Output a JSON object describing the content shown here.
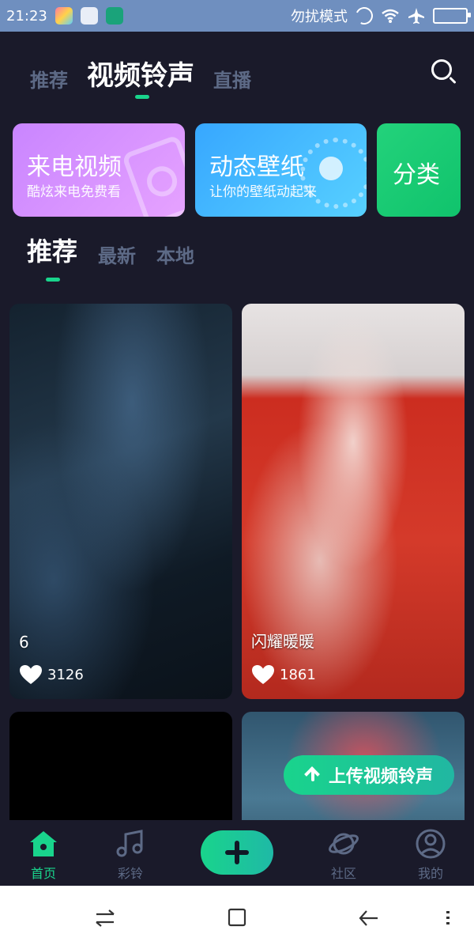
{
  "status_bar": {
    "time": "21:23",
    "status_text": "勿扰模式",
    "icons": [
      "photo-app-icon",
      "cleaner-icon",
      "usb-icon",
      "moon-icon",
      "wifi-icon",
      "airplane-icon",
      "battery-icon"
    ]
  },
  "top_tabs": [
    {
      "label": "推荐",
      "active": false
    },
    {
      "label": "视频铃声",
      "active": true
    },
    {
      "label": "直播",
      "active": false
    }
  ],
  "cards": [
    {
      "title": "来电视频",
      "subtitle": "酷炫来电免费看"
    },
    {
      "title": "动态壁纸",
      "subtitle": "让你的壁纸动起来"
    },
    {
      "title": "分类",
      "subtitle": ""
    }
  ],
  "section_tabs": [
    {
      "label": "推荐",
      "active": true
    },
    {
      "label": "最新",
      "active": false
    },
    {
      "label": "本地",
      "active": false
    }
  ],
  "videos": [
    {
      "title": "6",
      "likes": "3126"
    },
    {
      "title": "闪耀暖暖",
      "likes": "1861"
    },
    {
      "title": "",
      "likes": ""
    },
    {
      "title": "",
      "likes": ""
    }
  ],
  "upload_button": {
    "label": "上传视频铃声"
  },
  "bottom_nav": [
    {
      "label": "首页",
      "icon": "home-icon",
      "active": true
    },
    {
      "label": "彩铃",
      "icon": "music-note-icon",
      "active": false
    },
    {
      "label": "",
      "icon": "plus-icon",
      "active": false
    },
    {
      "label": "社区",
      "icon": "planet-icon",
      "active": false
    },
    {
      "label": "我的",
      "icon": "person-icon",
      "active": false
    }
  ],
  "colors": {
    "accent": "#19d48c",
    "background": "#1a1a2a",
    "inactive": "#5d6a86",
    "status_bar": "#6f8fbf"
  }
}
